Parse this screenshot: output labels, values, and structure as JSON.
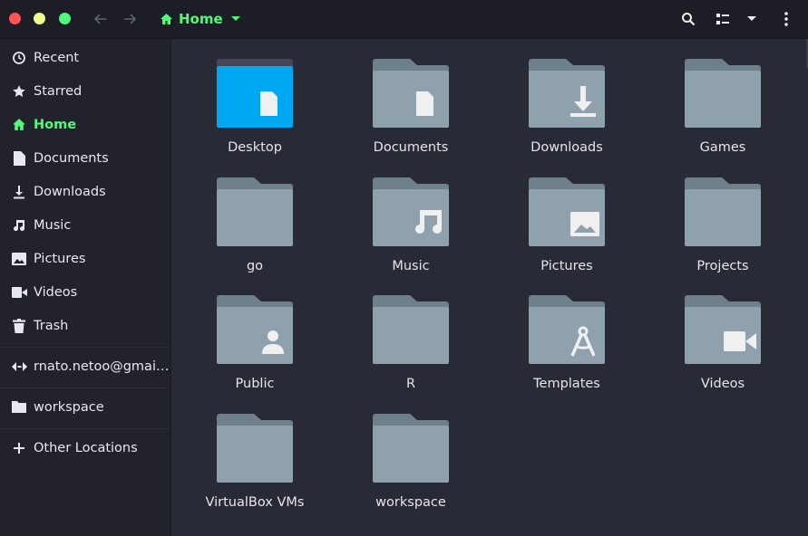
{
  "window": {
    "title": "Home",
    "controls": {
      "close": "close",
      "minimize": "minimize",
      "maximize": "maximize"
    }
  },
  "header": {
    "path_label": "Home",
    "icons": [
      "arrow-left-icon",
      "arrow-right-icon",
      "home-icon",
      "chevron-down-icon",
      "search-icon",
      "view-list-icon",
      "view-options-chevron-icon",
      "menu-kebab-icon"
    ]
  },
  "sidebar": {
    "items": [
      {
        "label": "Recent",
        "icon": "clock-icon"
      },
      {
        "label": "Starred",
        "icon": "star-icon"
      },
      {
        "label": "Home",
        "icon": "home-icon",
        "active": true
      },
      {
        "label": "Documents",
        "icon": "document-icon"
      },
      {
        "label": "Downloads",
        "icon": "download-icon"
      },
      {
        "label": "Music",
        "icon": "music-note-icon"
      },
      {
        "label": "Pictures",
        "icon": "image-icon"
      },
      {
        "label": "Videos",
        "icon": "video-camera-icon"
      },
      {
        "label": "Trash",
        "icon": "trash-icon"
      }
    ],
    "network": [
      {
        "label": "rnato.netoo@gmai…",
        "icon": "network-account-icon"
      }
    ],
    "bookmarks": [
      {
        "label": "workspace",
        "icon": "folder-icon"
      }
    ],
    "other": [
      {
        "label": "Other Locations",
        "icon": "plus-icon"
      }
    ]
  },
  "files": [
    {
      "label": "Desktop",
      "emblem": "document",
      "special": "desktop"
    },
    {
      "label": "Documents",
      "emblem": "document"
    },
    {
      "label": "Downloads",
      "emblem": "download"
    },
    {
      "label": "Games",
      "emblem": "none"
    },
    {
      "label": "go",
      "emblem": "none"
    },
    {
      "label": "Music",
      "emblem": "music"
    },
    {
      "label": "Pictures",
      "emblem": "image"
    },
    {
      "label": "Projects",
      "emblem": "none"
    },
    {
      "label": "Public",
      "emblem": "person"
    },
    {
      "label": "R",
      "emblem": "none"
    },
    {
      "label": "Templates",
      "emblem": "compass"
    },
    {
      "label": "Videos",
      "emblem": "video"
    },
    {
      "label": "VirtualBox VMs",
      "emblem": "none"
    },
    {
      "label": "workspace",
      "emblem": "none"
    }
  ],
  "colors": {
    "accent": "#50fa7b",
    "folder_body": "#8fa1ac",
    "folder_tab": "#6e808c",
    "desktop_body": "#00a8f3",
    "desktop_tab": "#44475a",
    "background": "#282a36",
    "sidebar": "#21222c",
    "header": "#1c1d25"
  }
}
